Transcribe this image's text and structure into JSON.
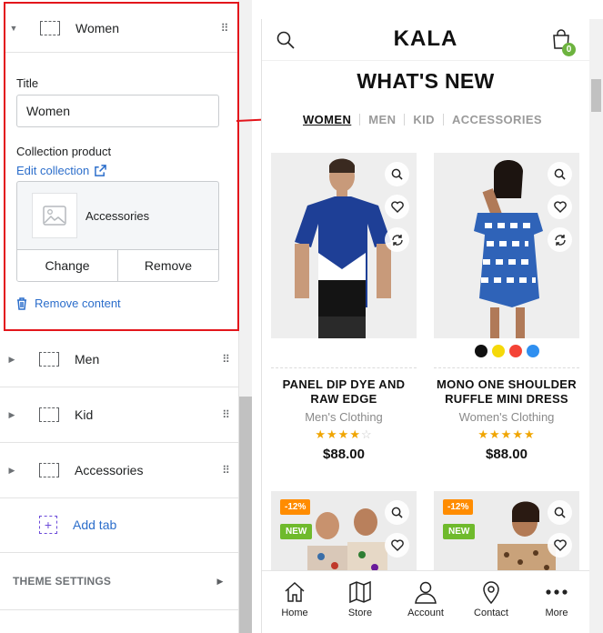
{
  "editor": {
    "expanded_tab": {
      "label": "Women",
      "title_label": "Title",
      "title_value": "Women",
      "collection_label": "Collection product",
      "edit_collection": "Edit collection",
      "collection_name": "Accessories",
      "change_label": "Change",
      "remove_label": "Remove",
      "remove_content": "Remove content"
    },
    "tabs": [
      {
        "label": "Men"
      },
      {
        "label": "Kid"
      },
      {
        "label": "Accessories"
      }
    ],
    "add_tab": "Add tab",
    "theme_settings": "THEME SETTINGS"
  },
  "preview": {
    "logo": "KALA",
    "cart_count": "0",
    "section_title": "WHAT'S NEW",
    "tabs": [
      "WOMEN",
      "MEN",
      "KID",
      "ACCESSORIES"
    ],
    "active_tab": "WOMEN",
    "products": [
      {
        "name_line1": "PANEL DIP DYE AND",
        "name_line2": "RAW EDGE",
        "category": "Men's Clothing",
        "rating": 4,
        "price": "$88.00"
      },
      {
        "name_line1": "MONO ONE SHOULDER",
        "name_line2": "RUFFLE MINI DRESS",
        "category": "Women's Clothing",
        "rating": 5,
        "price": "$88.00",
        "swatches": [
          "#111111",
          "#f5d90a",
          "#f44336",
          "#2f8ff0"
        ]
      }
    ],
    "lower_badges": [
      {
        "sale": "-12%",
        "new": "NEW"
      },
      {
        "sale": "-12%",
        "new": "NEW"
      }
    ],
    "bottom_nav": [
      "Home",
      "Store",
      "Account",
      "Contact",
      "More"
    ]
  },
  "colors": {
    "accent_link": "#2c6ecb",
    "highlight": "#e3161c",
    "badge_green": "#6db33f",
    "sale_orange": "#ff8c00"
  }
}
